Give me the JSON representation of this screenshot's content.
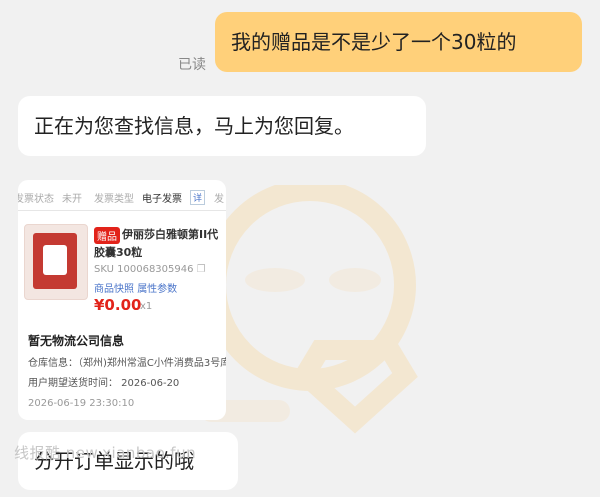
{
  "chat": {
    "outgoing_message": "我的赠品是不是少了一个30粒的",
    "read_status": "已读",
    "reply_message": "正在为您查找信息，马上为您回复。",
    "reply_message_2": "分开订单显示的哦"
  },
  "order_card": {
    "tabs": {
      "t1": "发票状态",
      "t2": "未开",
      "t3": "发票类型",
      "t4": "电子发票",
      "t5": "详",
      "t6": "发"
    },
    "gift_badge": "赠品",
    "product_name": "伊丽莎白雅顿第II代胶囊30粒",
    "sku": "SKU 100068305946",
    "snapshot_link": "商品快照",
    "params_link": "属性参数",
    "price": "¥0.00",
    "quantity": "x1",
    "logistics_title": "暂无物流公司信息",
    "warehouse": "仓库信息：（郑州)郑州常温C小件消费品3号库",
    "expected_time": "用户期望送货时间：  2026-06-20",
    "timestamp": "2026-06-19 23:30:10"
  },
  "watermark": {
    "site": "线报酷 new.xianbao.fun"
  },
  "colors": {
    "outgoing_bubble": "#ffd07a",
    "price_red": "#e2231a",
    "link_blue": "#4a74c9"
  }
}
